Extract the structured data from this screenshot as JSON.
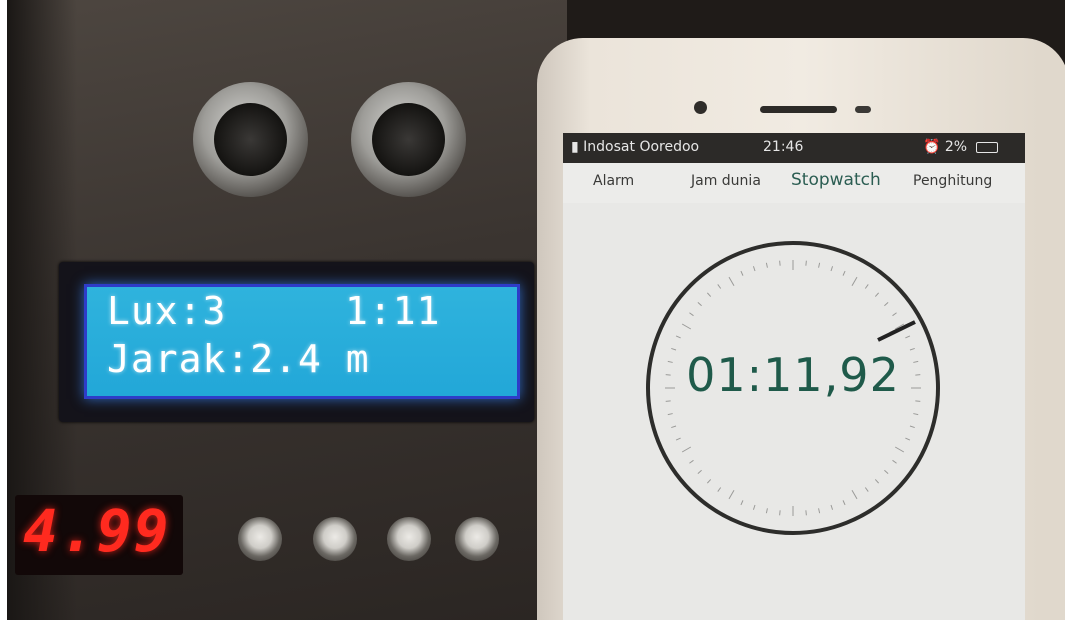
{
  "lcd": {
    "line1_left": "Lux:3",
    "line1_right": "1:11",
    "line2": "Jarak:2.4 m"
  },
  "seven_segment": {
    "value": "4.99"
  },
  "phone": {
    "status": {
      "carrier": "Indosat Ooredoo",
      "time": "21:46",
      "battery_text": "2%"
    },
    "tabs": [
      "Alarm",
      "Jam dunia",
      "Stopwatch",
      "Penghitung"
    ],
    "active_tab": "Stopwatch",
    "stopwatch_time": "01:11,92"
  },
  "colors": {
    "lcd_background": "#22a7d8",
    "segment_display": "#ff2a1f",
    "stopwatch_text": "#1f5a4a"
  },
  "icons": [
    "signal-icon",
    "alarm-clock-icon",
    "battery-icon"
  ]
}
